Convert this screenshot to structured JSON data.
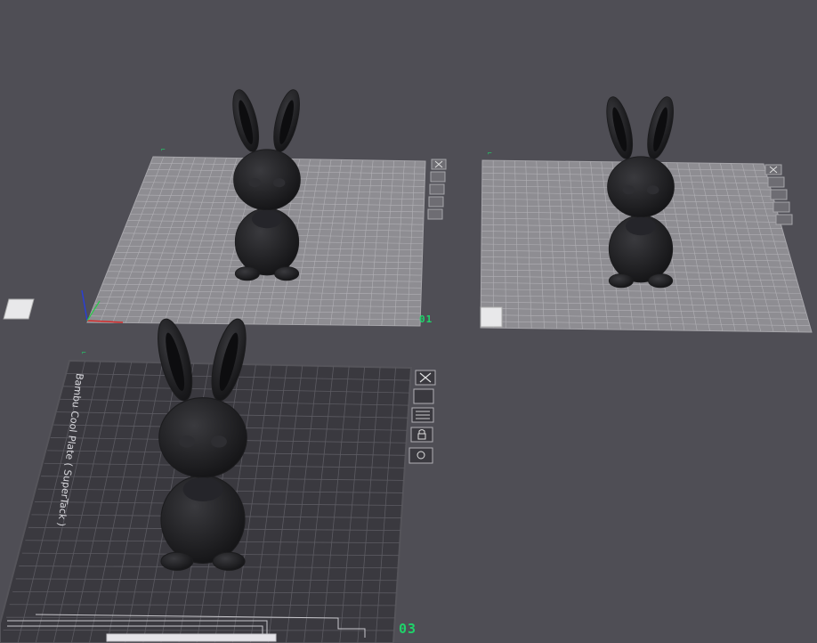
{
  "viewport": {
    "background": "#4f4e55",
    "plates": [
      {
        "label": "01",
        "state": "inactive",
        "tools": [
          "close-icon",
          "arrange-icon",
          "layers-icon",
          "lock-icon",
          "settings-icon"
        ],
        "model": "bunny"
      },
      {
        "label": "",
        "state": "inactive",
        "tools": [
          "close-icon",
          "arrange-icon",
          "layers-icon",
          "lock-icon",
          "settings-icon"
        ],
        "model": "bunny"
      },
      {
        "label": "03",
        "state": "active",
        "name": "Bambu Cool Plate ( SuperTack )",
        "tools": [
          "close-icon",
          "arrange-icon",
          "layers-icon",
          "lock-icon",
          "settings-icon"
        ],
        "model": "bunny"
      }
    ],
    "colors": {
      "plate_inactive": "#8e8d92",
      "plate_active": "#3a393f",
      "grid_line": "#b9b8bd",
      "label_green": "#1fd36a",
      "model": "#1c1c1e",
      "axis_x": "#d42a2a",
      "axis_y": "#2ac94a",
      "axis_z": "#2a3fd4"
    }
  }
}
